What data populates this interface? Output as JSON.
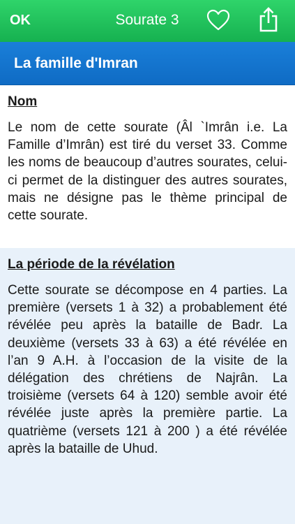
{
  "navbar": {
    "ok_label": "OK",
    "title": "Sourate 3",
    "heart_icon": "heart-outline-icon",
    "share_icon": "share-icon"
  },
  "header": {
    "title": "La famille d'Imran"
  },
  "sections": [
    {
      "heading": "Nom",
      "body": "Le nom de cette sourate (Âl `Imrân i.e. La Famille d’Imrân) est tiré du verset 33. Comme les noms de beaucoup d’autres sourates, celui-ci permet de la distinguer des autres sourates, mais ne désigne pas le thème principal de cette sourate."
    },
    {
      "heading": "La période de la révélation",
      "body": "Cette sourate se décompose en 4 parties. La première (versets 1 à 32) a probablement été révélée peu après la bataille de Badr. La deuxième (versets 33 à 63) a été révélée en l’an 9 A.H. à l’occasion de la visite de la délégation des chrétiens de Najrân. La troisième (versets 64 à 120) semble avoir été révélée juste après la première partie. La quatrième (versets 121 à 200 ) a été révélée après la bataille de Uhud."
    }
  ],
  "colors": {
    "navbar_green": "#1fc15b",
    "header_blue": "#1575cf",
    "section_alt_bg": "#e8f1fa"
  }
}
